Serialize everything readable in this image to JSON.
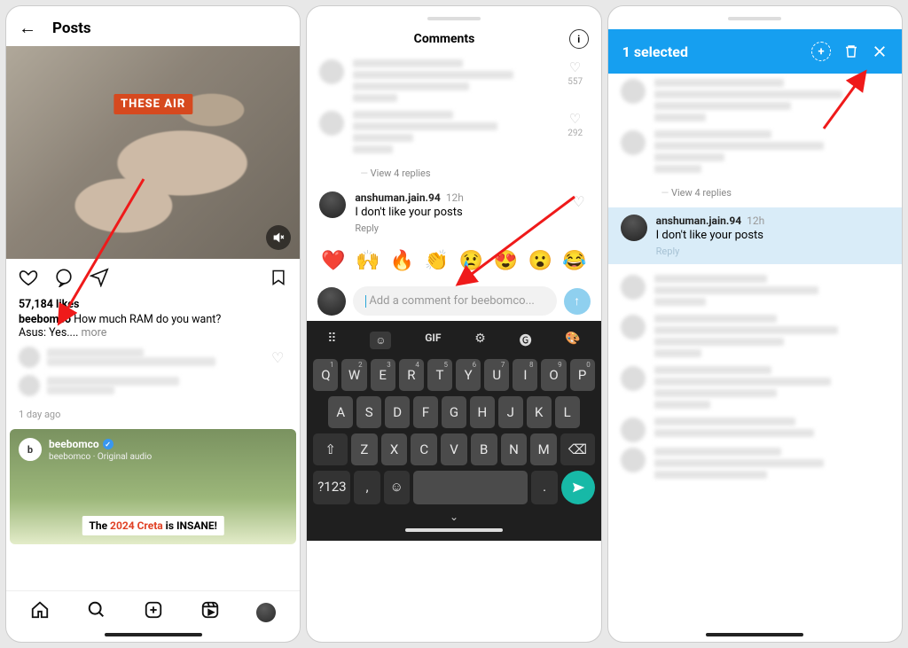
{
  "panel1": {
    "header_title": "Posts",
    "caption_badge": "THESE AIR",
    "likes": "57,184 likes",
    "username": "beebomco",
    "caption_q": "How much RAM do you want?",
    "caption_a": "Asus: Yes....",
    "more": " more",
    "time": "1 day ago",
    "reel": {
      "name": "beebomco",
      "sub": "beebomco · Original audio",
      "avatar_initial": "b",
      "overlay_pre": "The ",
      "overlay_red": "2024 Creta",
      "overlay_post": " is INSANE!"
    }
  },
  "panel2": {
    "title": "Comments",
    "count1": "557",
    "count2": "292",
    "view_replies": "View 4 replies",
    "comment": {
      "user": "anshuman.jain.94",
      "time": "12h",
      "text": "I don't like your posts",
      "reply": "Reply"
    },
    "emojis": [
      "❤️",
      "🙌",
      "🔥",
      "👏",
      "😢",
      "😍",
      "😮",
      "😂"
    ],
    "placeholder": "Add a comment for beebomco...",
    "kbd": {
      "gif": "GIF",
      "row1": [
        "Q",
        "W",
        "E",
        "R",
        "T",
        "Y",
        "U",
        "I",
        "O",
        "P"
      ],
      "row1sub": [
        "1",
        "2",
        "3",
        "4",
        "5",
        "6",
        "7",
        "8",
        "9",
        "0"
      ],
      "row2": [
        "A",
        "S",
        "D",
        "F",
        "G",
        "H",
        "J",
        "K",
        "L"
      ],
      "row3": [
        "Z",
        "X",
        "C",
        "V",
        "B",
        "N",
        "M"
      ],
      "num": "?123",
      "comma": ",",
      "period": "."
    }
  },
  "panel3": {
    "bar_title": "1 selected",
    "view_replies": "View 4 replies",
    "comment": {
      "user": "anshuman.jain.94",
      "time": "12h",
      "text": "I don't like your posts",
      "reply": "Reply"
    }
  }
}
